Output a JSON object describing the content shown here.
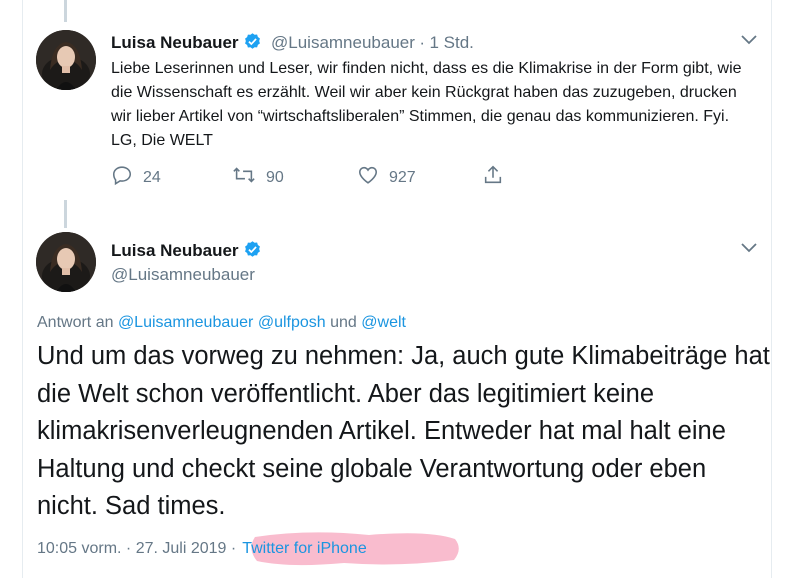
{
  "tweet1": {
    "author_name": "Luisa Neubauer",
    "handle": "@Luisamneubauer",
    "separator": "·",
    "time": "1 Std.",
    "text": "Liebe Leserinnen und Leser, wir finden nicht, dass es die Klimakrise in der Form gibt, wie die Wissenschaft es erzählt. Weil wir aber kein Rückgrat haben das zuzugeben, drucken wir lieber Artikel von “wirtschaftsliberalen” Stimmen, die genau das kommunizieren. Fyi. LG, Die WELT",
    "replies": "24",
    "retweets": "90",
    "likes": "927"
  },
  "tweet2": {
    "author_name": "Luisa Neubauer",
    "handle": "@Luisamneubauer",
    "reply_prefix": "Antwort an",
    "reply_mentions": [
      "@Luisamneubauer",
      "@ulfposh",
      "@welt"
    ],
    "reply_and": "und",
    "text": "Und um das vorweg zu nehmen: Ja, auch gute Klimabeiträge hat die Welt schon veröffentlicht. Aber das legitimiert keine klimakrisenverleugnenden Artikel. Entweder hat mal halt eine Haltung und checkt seine globale Verantwortung oder eben nicht. Sad times.",
    "timestamp": "10:05 vorm. · 27. Juli 2019 ·",
    "source": "Twitter for iPhone"
  },
  "colors": {
    "text": "#14171a",
    "secondary": "#657786",
    "link": "#1b95e0",
    "verified": "#1da1f2",
    "highlight": "#f7a6bd"
  },
  "icons": [
    "verified-badge-icon",
    "chevron-down-icon",
    "reply-icon",
    "retweet-icon",
    "like-icon",
    "share-icon"
  ]
}
